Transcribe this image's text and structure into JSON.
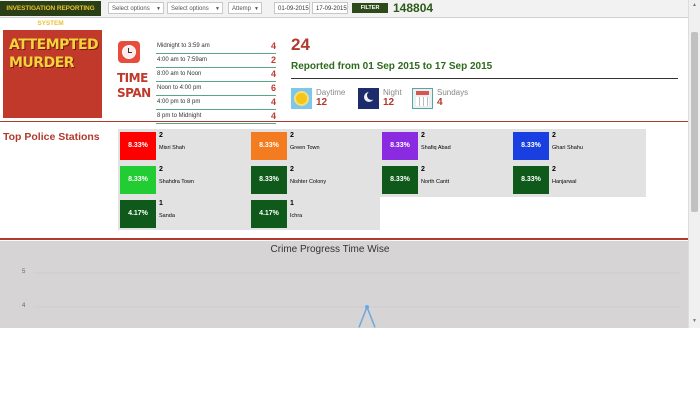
{
  "toolbar": {
    "brand": "INVESTIGATION REPORTING SYSTEM",
    "select1_placeholder": "Select options",
    "select2_placeholder": "Select options",
    "select3_value": "Attemp",
    "date_from": "01-09-2015",
    "date_to": "17-09-2015",
    "filter_label": "FILTER",
    "total_count": "148804"
  },
  "crime": {
    "type_line1": "ATTEMPTED",
    "type_line2": "MURDER",
    "time_span_line1": "TIME",
    "time_span_line2": "SPAN",
    "slots": [
      {
        "label": "Midnight to 3:59 am",
        "count": "4"
      },
      {
        "label": "4:00 am to 7:59am",
        "count": "2"
      },
      {
        "label": "8:00 am to Noon",
        "count": "4"
      },
      {
        "label": "Noon to 4:00 pm",
        "count": "6"
      },
      {
        "label": "4:00 pm to 8 pm",
        "count": "4"
      },
      {
        "label": "8 pm to Midnight",
        "count": "4"
      }
    ]
  },
  "summary": {
    "total": "24",
    "reported": "Reported from 01 Sep 2015 to 17 Sep 2015",
    "daytime_label": "Daytime",
    "daytime_value": "12",
    "night_label": "Night",
    "night_value": "12",
    "sundays_label": "Sundays",
    "sundays_value": "4"
  },
  "stations": {
    "title": "Top Police Stations",
    "items": [
      {
        "pct": "8.33%",
        "count": "2",
        "name": "Misri Shah",
        "color": "#ff0000"
      },
      {
        "pct": "8.33%",
        "count": "2",
        "name": "Green Town",
        "color": "#f47c20"
      },
      {
        "pct": "8.33%",
        "count": "2",
        "name": "Shafiq Abad",
        "color": "#8a2be2"
      },
      {
        "pct": "8.33%",
        "count": "2",
        "name": "Ghari Shahu",
        "color": "#1a3fe0"
      },
      {
        "pct": "8.33%",
        "count": "2",
        "name": "Shahdra Town",
        "color": "#22cc33"
      },
      {
        "pct": "8.33%",
        "count": "2",
        "name": "Nishter Colony",
        "color": "#0f5a1a"
      },
      {
        "pct": "8.33%",
        "count": "2",
        "name": "North Cantt",
        "color": "#0f5a1a"
      },
      {
        "pct": "8.33%",
        "count": "2",
        "name": "Hanjarwal",
        "color": "#0f5a1a"
      },
      {
        "pct": "4.17%",
        "count": "1",
        "name": "Sanda",
        "color": "#0f5a1a"
      },
      {
        "pct": "4.17%",
        "count": "1",
        "name": "Ichra",
        "color": "#0f5a1a"
      }
    ]
  },
  "chart_data": {
    "type": "line",
    "title": "Crime Progress Time Wise",
    "xlabel": "",
    "ylabel": "",
    "ylim": [
      3.4,
      5.2
    ],
    "y_ticks": [
      "5",
      "4"
    ],
    "series": [
      {
        "color": "#6aa8e0",
        "x": [
          0,
          1,
          2
        ],
        "y": [
          3.4,
          4,
          3.4
        ]
      }
    ],
    "grid": true
  }
}
